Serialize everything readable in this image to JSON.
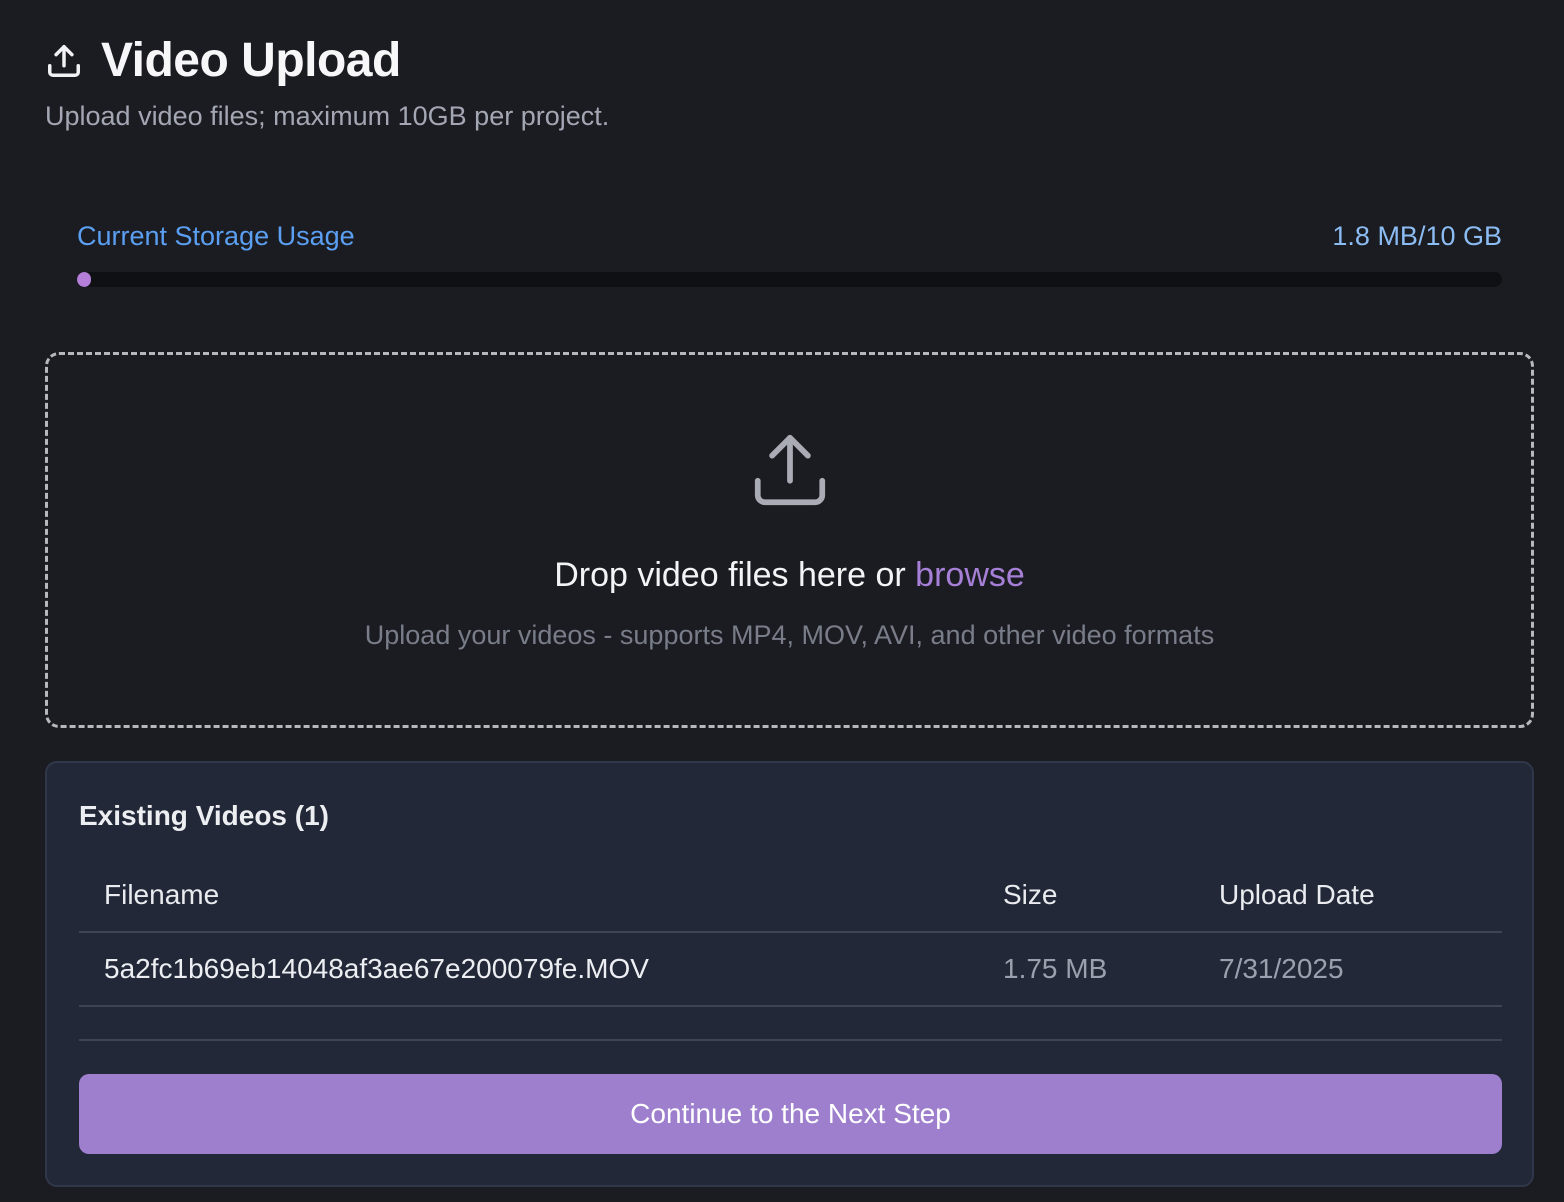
{
  "header": {
    "title": "Video Upload",
    "subtitle": "Upload video files; maximum 10GB per project.",
    "icon": "upload-icon"
  },
  "storage": {
    "label": "Current Storage Usage",
    "value": "1.8 MB/10 GB",
    "used_fraction": 0.00018
  },
  "dropzone": {
    "icon": "upload-icon",
    "prompt": "Drop video files here or",
    "browse_label": "browse",
    "hint": "Upload your videos - supports MP4, MOV, AVI, and other video formats"
  },
  "videos": {
    "title": "Existing Videos (1)",
    "columns": {
      "filename": "Filename",
      "size": "Size",
      "date": "Upload Date"
    },
    "rows": [
      {
        "filename": "5a2fc1b69eb14048af3ae67e200079fe.MOV",
        "size": "1.75 MB",
        "date": "7/31/2025"
      }
    ]
  },
  "continue_button": {
    "label": "Continue to the Next Step"
  },
  "colors": {
    "background": "#1b1c21",
    "accent_purple": "#9d7fce",
    "link_purple": "#a67fd6",
    "storage_label_blue": "#5b9ff2",
    "progress_fill": "#b57ed9",
    "card_background": "#222837"
  }
}
